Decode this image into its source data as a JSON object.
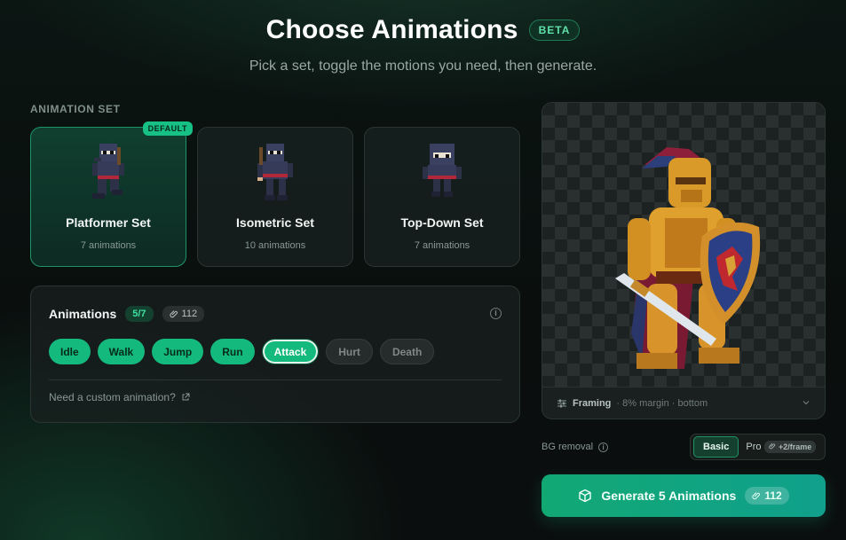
{
  "header": {
    "title": "Choose Animations",
    "beta": "BETA",
    "subtitle": "Pick a set, toggle the motions you need, then generate."
  },
  "animation_set": {
    "label": "ANIMATION SET",
    "default_badge": "DEFAULT",
    "sets": [
      {
        "name": "Platformer Set",
        "count": "7 animations",
        "selected": true
      },
      {
        "name": "Isometric Set",
        "count": "10 animations",
        "selected": false
      },
      {
        "name": "Top-Down Set",
        "count": "7 animations",
        "selected": false
      }
    ]
  },
  "animations": {
    "title": "Animations",
    "selected_count": "5/7",
    "cost": "112",
    "chips": [
      {
        "label": "Idle",
        "state": "on"
      },
      {
        "label": "Walk",
        "state": "on"
      },
      {
        "label": "Jump",
        "state": "on"
      },
      {
        "label": "Run",
        "state": "on"
      },
      {
        "label": "Attack",
        "state": "focus"
      },
      {
        "label": "Hurt",
        "state": "off"
      },
      {
        "label": "Death",
        "state": "off"
      }
    ],
    "custom_link": "Need a custom animation?"
  },
  "preview": {
    "framing_label": "Framing",
    "framing_detail": "· 8% margin · bottom"
  },
  "bg_removal": {
    "label": "BG removal",
    "options": [
      "Basic",
      "Pro"
    ],
    "selected": "Basic",
    "pro_cost": "+2/frame"
  },
  "generate": {
    "label": "Generate 5 Animations",
    "cost": "112"
  },
  "colors": {
    "accent": "#14b97d",
    "accent_dark": "#1d9466",
    "background": "#0a0f0e"
  }
}
